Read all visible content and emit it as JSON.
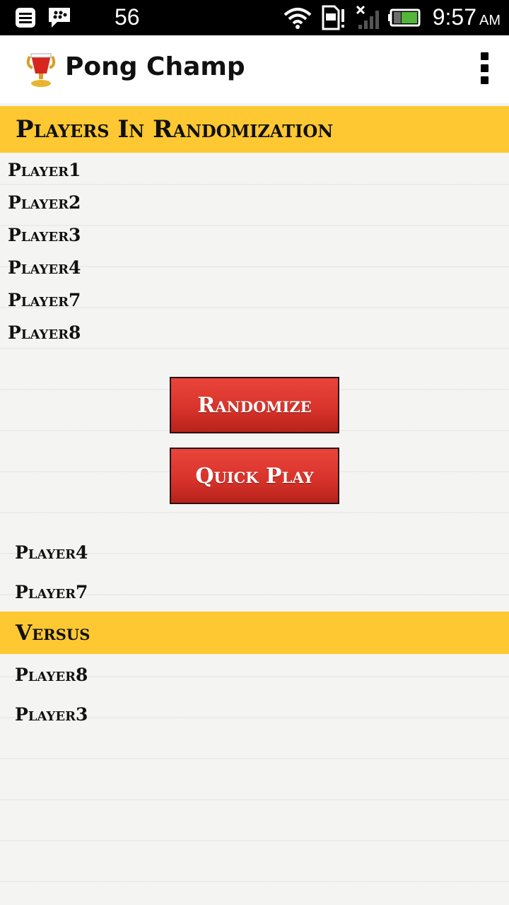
{
  "status_bar": {
    "notification_count": "56",
    "time": "9:57",
    "ampm": "AM",
    "icons": [
      "messages-icon",
      "bbm-icon",
      "wifi-icon",
      "sim-alert-icon",
      "no-signal-icon",
      "battery-icon"
    ]
  },
  "app_bar": {
    "title": "Pong Champ",
    "logo": "trophy-cup-icon",
    "menu": "overflow-menu-icon"
  },
  "randomization": {
    "header": "Players In Randomization",
    "players": [
      "Player1",
      "Player2",
      "Player3",
      "Player4",
      "Player7",
      "Player8"
    ]
  },
  "buttons": {
    "randomize": "Randomize",
    "quick_play": "Quick Play"
  },
  "matchup": {
    "team_a": [
      "Player4",
      "Player7"
    ],
    "versus": "Versus",
    "team_b": [
      "Player8",
      "Player3"
    ]
  },
  "colors": {
    "header_yellow": "#fdc832",
    "button_red": "#d9342b",
    "status_bar": "#000000"
  }
}
